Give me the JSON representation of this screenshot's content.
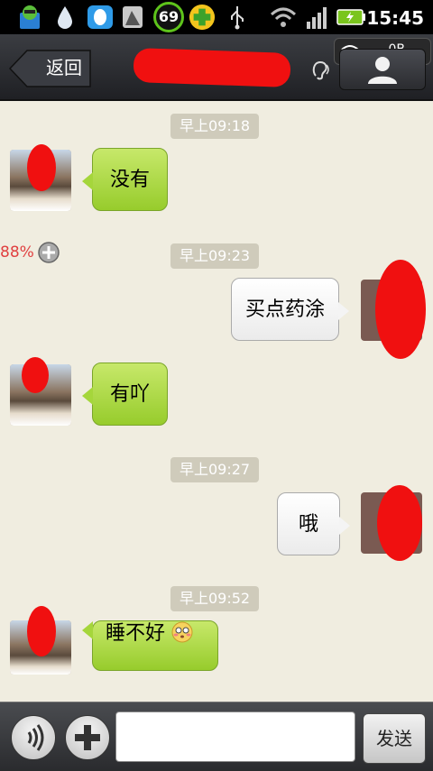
{
  "status_bar": {
    "battery_badge": "69",
    "time": "15:45",
    "icons": [
      "app-icon",
      "water-drop-icon",
      "qq-icon",
      "wallpaper-icon",
      "battery-badge-icon",
      "plus-cross-icon",
      "usb-icon",
      "wifi-icon",
      "signal-icon",
      "battery-charging-icon"
    ]
  },
  "title_bar": {
    "back_label": "返回",
    "network_speed": "0B",
    "icons": [
      "ear-icon",
      "wifi-small-icon",
      "contact-profile-icon"
    ]
  },
  "chat": {
    "zoom_percent": "88%",
    "messages": [
      {
        "time": "早上09:18",
        "side": "left",
        "text": "没有"
      },
      {
        "time": "早上09:23",
        "side": "right",
        "text": "买点药涂"
      },
      {
        "time": "",
        "side": "left",
        "text": "有吖"
      },
      {
        "time": "早上09:27",
        "side": "right",
        "text": "哦"
      },
      {
        "time": "早上09:52",
        "side": "left",
        "text": "睡不好",
        "emoji": "flushed-face-emoji"
      }
    ]
  },
  "input_bar": {
    "input_value": "",
    "send_label": "发送",
    "icons": [
      "voice-icon",
      "plus-icon"
    ]
  },
  "colors": {
    "left_bubble": "#a5d63b",
    "right_bubble": "#f4f4f4",
    "chat_background": "#f0ede0",
    "time_badge": "#cfcbbb",
    "redaction": "#f01010"
  }
}
